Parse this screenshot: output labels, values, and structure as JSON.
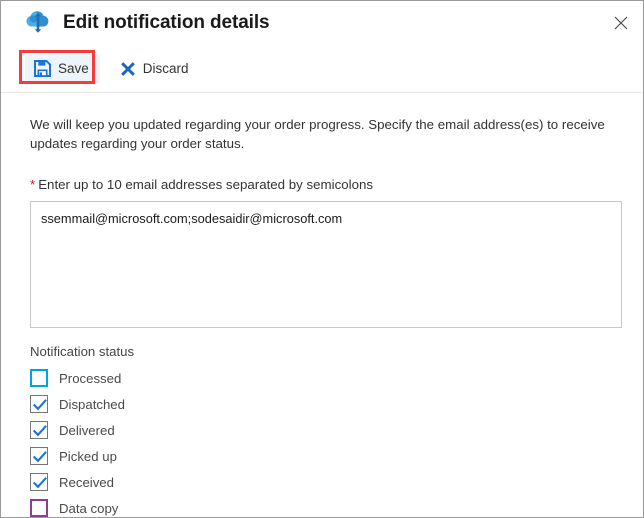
{
  "window": {
    "title": "Edit notification details",
    "app_icon": "cloud-sync-icon",
    "close_icon": "close-icon"
  },
  "commandbar": {
    "save": {
      "label": "Save",
      "icon": "save-floppy-icon"
    },
    "discard": {
      "label": "Discard",
      "icon": "discard-x-icon"
    },
    "highlight_color": "#f93a3a"
  },
  "content": {
    "description": "We will keep you updated regarding your order progress. Specify the email address(es) to receive updates regarding your order status.",
    "email_field": {
      "required_marker": "*",
      "label": "Enter up to 10 email addresses separated by semicolons",
      "value": "ssemmail@microsoft.com;sodesaidir@microsoft.com",
      "placeholder": ""
    },
    "notification_status": {
      "label": "Notification status",
      "items": [
        {
          "label": "Processed",
          "checked": false,
          "accent": "blue"
        },
        {
          "label": "Dispatched",
          "checked": true,
          "accent": "none"
        },
        {
          "label": "Delivered",
          "checked": true,
          "accent": "none"
        },
        {
          "label": "Picked up",
          "checked": true,
          "accent": "none"
        },
        {
          "label": "Received",
          "checked": true,
          "accent": "none"
        },
        {
          "label": "Data copy",
          "checked": false,
          "accent": "purple"
        }
      ]
    }
  },
  "colors": {
    "accent_blue": "#0078d4",
    "check_blue": "#1b72d8",
    "focus_cyan": "#00a2e8",
    "purple": "#8d3d92",
    "required_red": "#e81123",
    "annotation_red": "#f93a3a"
  }
}
